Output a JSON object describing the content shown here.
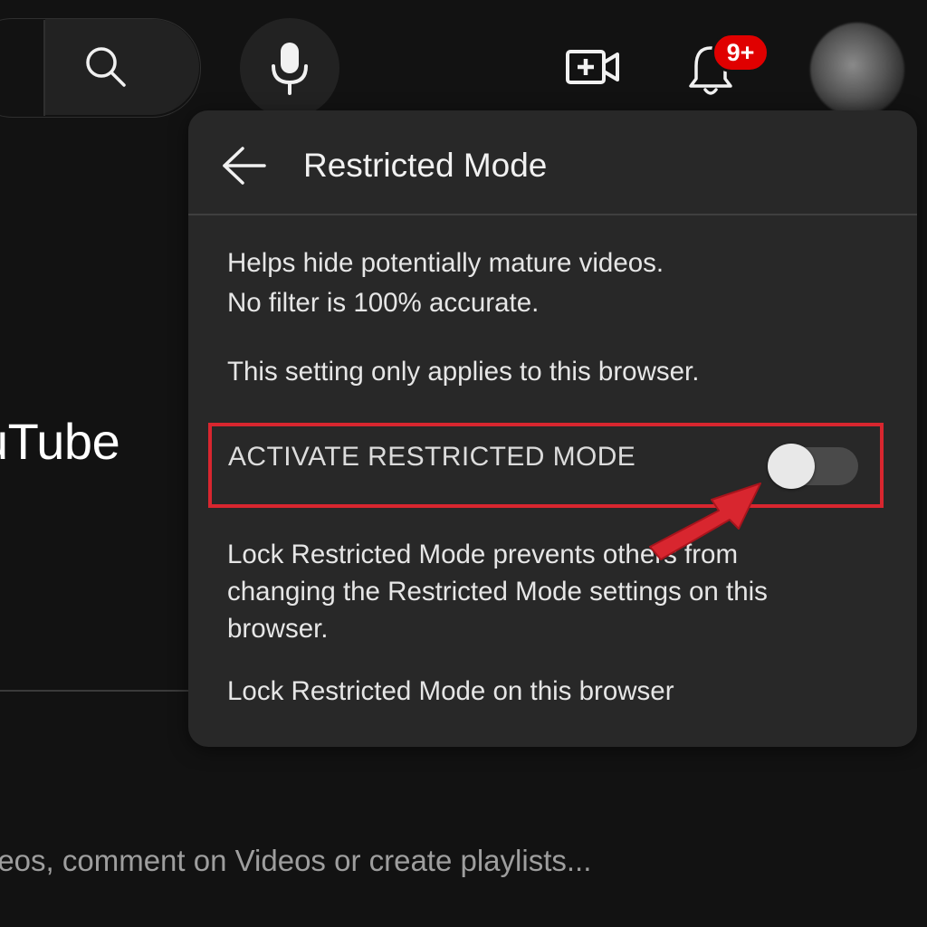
{
  "header": {
    "notification_count": "9+"
  },
  "background": {
    "logo_text": "uTube",
    "bottom_text": "leos, comment on Videos or create playlists..."
  },
  "panel": {
    "title": "Restricted Mode",
    "description_line1": "Helps hide potentially mature videos.",
    "description_line2": "No filter is 100% accurate.",
    "browser_note": "This setting only applies to this browser.",
    "activate_label": "ACTIVATE RESTRICTED MODE",
    "toggle_state": "off",
    "lock_description": "Lock Restricted Mode prevents others from changing the Restricted Mode settings on this browser.",
    "lock_link": "Lock Restricted Mode on this browser"
  },
  "icons": {
    "search": "search-icon",
    "mic": "mic-icon",
    "create": "create-video-icon",
    "bell": "bell-icon",
    "back": "back-arrow-icon"
  },
  "colors": {
    "background": "#121212",
    "panel": "#282828",
    "highlight": "#d8262f",
    "badge": "#e00000",
    "annotation_arrow": "#d8262f"
  }
}
